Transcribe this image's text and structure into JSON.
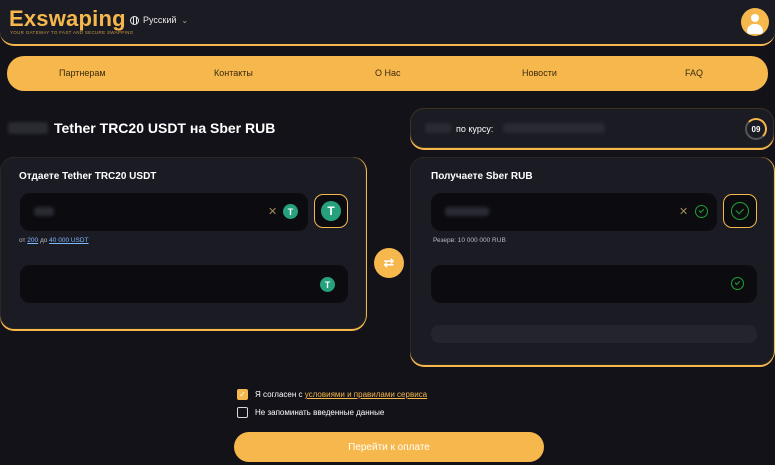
{
  "header": {
    "logo": "Exswaping",
    "tagline": "YOUR GATEWAY TO FAST AND SECURE SWAPPING",
    "language": "Русский"
  },
  "nav": {
    "items": [
      "Партнерам",
      "Контакты",
      "О Нас",
      "Новости",
      "FAQ"
    ]
  },
  "exchange": {
    "pair_title": "Tether TRC20 USDT на Sber RUB",
    "rate_label": "по курсу:",
    "timer": "09"
  },
  "give": {
    "title": "Отдаете Tether TRC20 USDT",
    "coin_symbol": "T",
    "limits_from": "от",
    "limits_min": "200",
    "limits_to": "до",
    "limits_max": "40 000 USDT"
  },
  "receive": {
    "title": "Получаете Sber RUB",
    "reserve": "Резерв: 10 000 000 RUB"
  },
  "agreement": {
    "prefix": "Я согласен с",
    "link": "условиями и правилами сервиса",
    "remember": "Не запоминать введенные данные",
    "agree_checked": true,
    "remember_checked": false
  },
  "pay_button": "Перейти к оплате",
  "colors": {
    "accent": "#f6b84c",
    "background": "#121218",
    "card": "#1b1b23",
    "field": "#0c0c10",
    "tether": "#26a17b",
    "sber": "#21a038"
  }
}
